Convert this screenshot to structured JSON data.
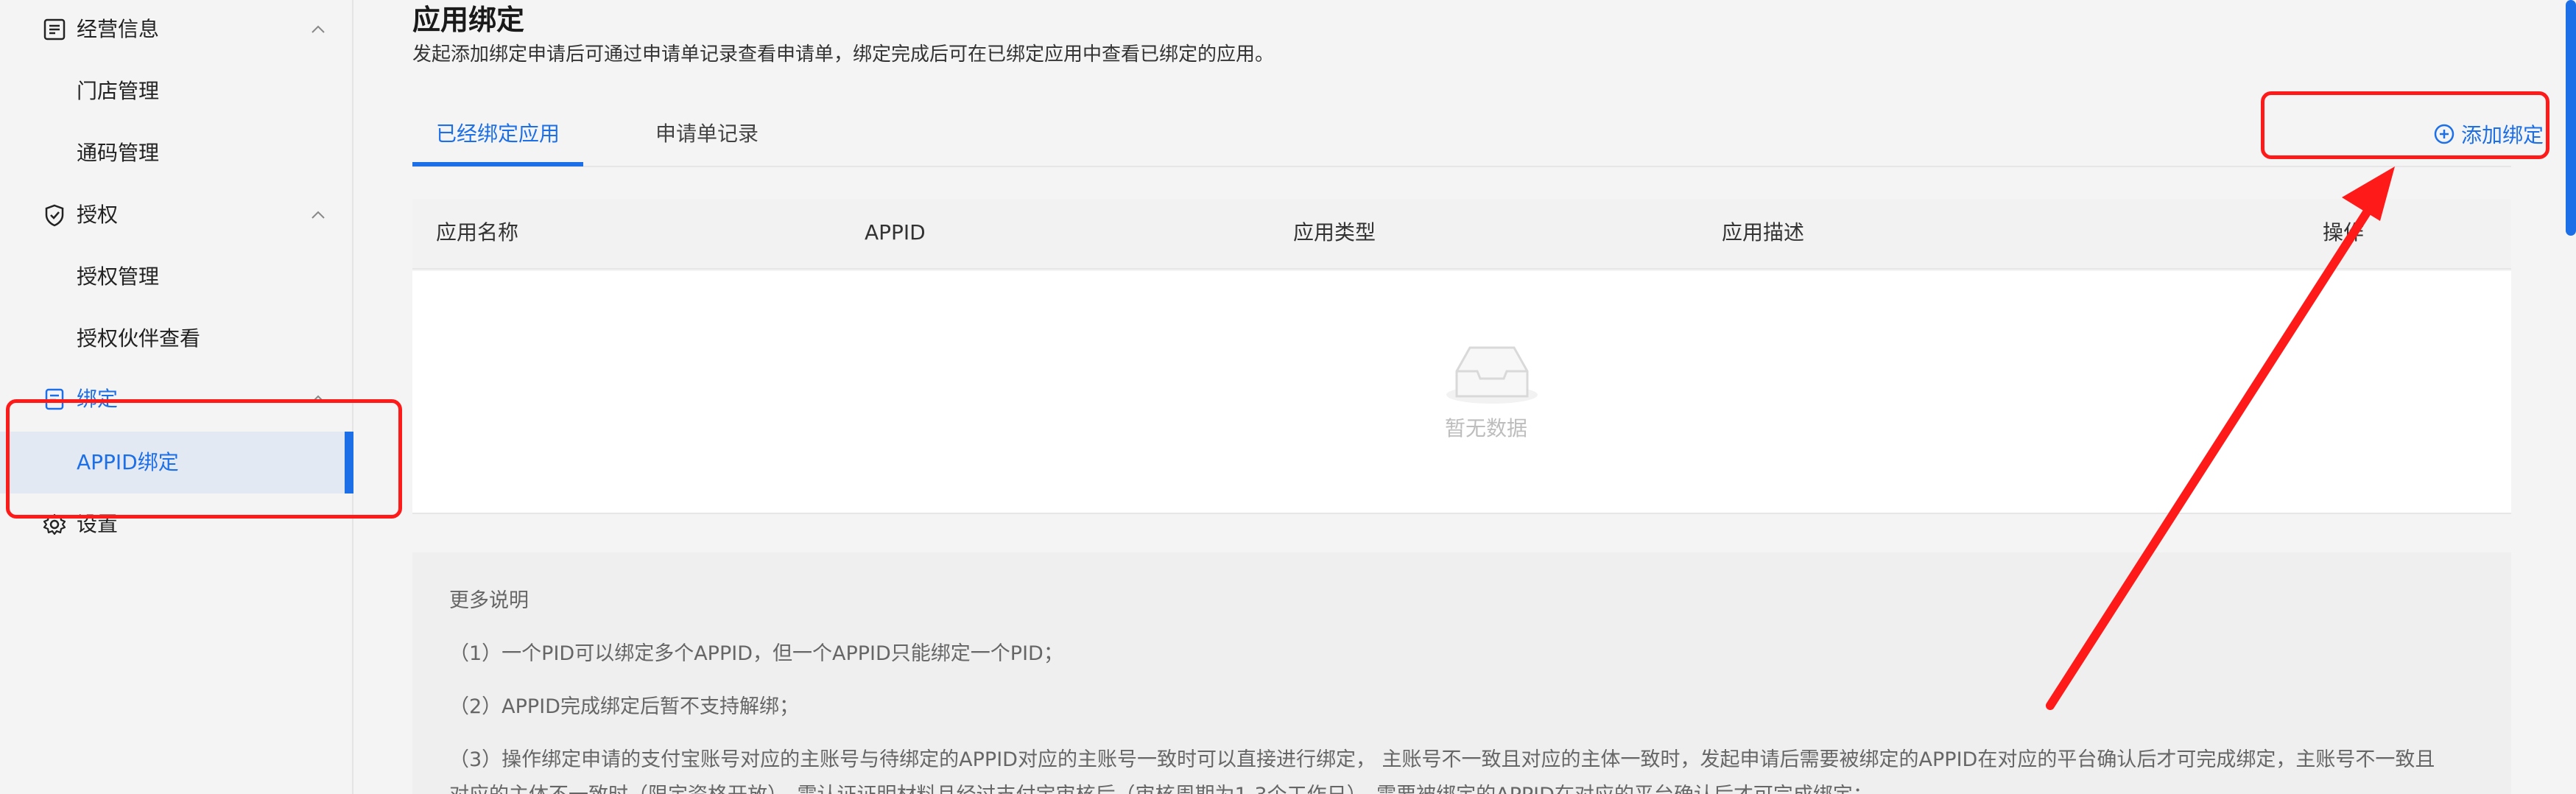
{
  "sidebar": {
    "groups": [
      {
        "label": "经营信息",
        "icon": "list-icon"
      },
      {
        "label": "授权",
        "icon": "shield-check-icon"
      },
      {
        "label": "绑定",
        "icon": "document-icon"
      },
      {
        "label": "设置",
        "icon": "gear-icon"
      }
    ],
    "items": {
      "store_mgmt": "门店管理",
      "code_mgmt": "通码管理",
      "auth_mgmt": "授权管理",
      "auth_partner": "授权伙伴查看",
      "appid_bind": "APPID绑定"
    }
  },
  "main": {
    "title": "应用绑定",
    "description": "发起添加绑定申请后可通过申请单记录查看申请单，绑定完成后可在已绑定应用中查看已绑定的应用。",
    "tabs": [
      {
        "label": "已经绑定应用",
        "active": true
      },
      {
        "label": "申请单记录",
        "active": false
      }
    ],
    "add_button": "添加绑定",
    "table": {
      "columns": [
        "应用名称",
        "APPID",
        "应用类型",
        "应用描述",
        "操作"
      ],
      "empty_text": "暂无数据"
    },
    "notes": {
      "title": "更多说明",
      "items": [
        "（1）一个PID可以绑定多个APPID，但一个APPID只能绑定一个PID；",
        "（2）APPID完成绑定后暂不支持解绑；",
        "（3）操作绑定申请的支付宝账号对应的主账号与待绑定的APPID对应的主账号一致时可以直接进行绑定， 主账号不一致且对应的主体一致时，发起申请后需要被绑定的APPID在对应的平台确认后才可完成绑定，主账号不一致且",
        "对应的主体不一致时（限定资格开放），需认证证明材料且经过支付宝审核后（审核周期为1-3个工作日），需要被绑定的APPID在对应的平台确认后才可完成绑定；"
      ]
    }
  },
  "colors": {
    "accent": "#1d6fe8",
    "annotation": "#ff1a1a"
  }
}
